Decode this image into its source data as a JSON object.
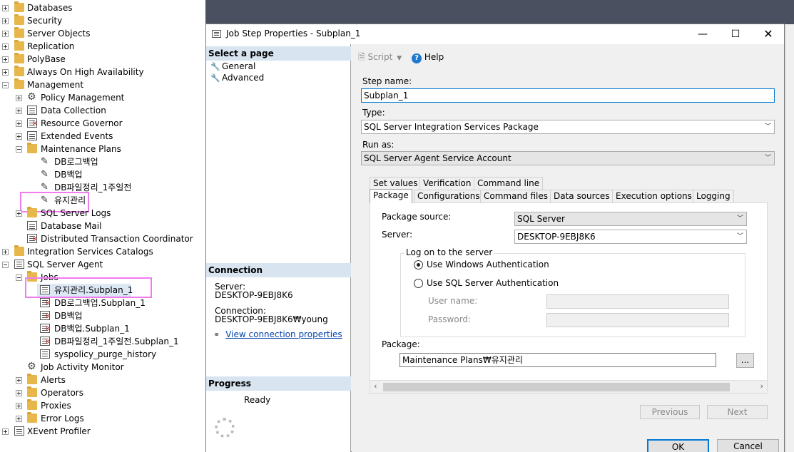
{
  "tree": {
    "items": [
      {
        "label": "Databases",
        "icon": "folder-icon"
      },
      {
        "label": "Security",
        "icon": "folder-icon"
      },
      {
        "label": "Server Objects",
        "icon": "folder-icon"
      },
      {
        "label": "Replication",
        "icon": "folder-icon"
      },
      {
        "label": "PolyBase",
        "icon": "folder-icon"
      },
      {
        "label": "Always On High Availability",
        "icon": "folder-icon"
      },
      {
        "label": "Management",
        "icon": "folder-icon"
      },
      {
        "label": "Policy Management",
        "icon": "policy-icon"
      },
      {
        "label": "Data Collection",
        "icon": "data-collection-icon"
      },
      {
        "label": "Resource Governor",
        "icon": "resource-governor-icon"
      },
      {
        "label": "Extended Events",
        "icon": "extended-events-icon"
      },
      {
        "label": "Maintenance Plans",
        "icon": "folder-icon"
      },
      {
        "label": "DB로그백업",
        "icon": "maintenance-plan-icon"
      },
      {
        "label": "DB백업",
        "icon": "maintenance-plan-icon"
      },
      {
        "label": "DB파일정리_1주일전",
        "icon": "maintenance-plan-icon"
      },
      {
        "label": "유지관리",
        "icon": "maintenance-plan-icon"
      },
      {
        "label": "SQL Server Logs",
        "icon": "folder-icon"
      },
      {
        "label": "Database Mail",
        "icon": "database-mail-icon"
      },
      {
        "label": "Distributed Transaction Coordinator",
        "icon": "dtc-icon"
      },
      {
        "label": "Integration Services Catalogs",
        "icon": "folder-icon"
      },
      {
        "label": "SQL Server Agent",
        "icon": "sql-agent-icon"
      },
      {
        "label": "Jobs",
        "icon": "folder-icon"
      },
      {
        "label": "유지관리.Subplan_1",
        "icon": "job-icon"
      },
      {
        "label": "DB로그백업.Subplan_1",
        "icon": "job-failed-icon"
      },
      {
        "label": "DB백업",
        "icon": "job-failed-icon"
      },
      {
        "label": "DB백업.Subplan_1",
        "icon": "job-failed-icon"
      },
      {
        "label": "DB파일정리_1주일전.Subplan_1",
        "icon": "job-failed-icon"
      },
      {
        "label": "syspolicy_purge_history",
        "icon": "job-icon"
      },
      {
        "label": "Job Activity Monitor",
        "icon": "job-activity-monitor-icon"
      },
      {
        "label": "Alerts",
        "icon": "folder-icon"
      },
      {
        "label": "Operators",
        "icon": "folder-icon"
      },
      {
        "label": "Proxies",
        "icon": "folder-icon"
      },
      {
        "label": "Error Logs",
        "icon": "folder-icon"
      },
      {
        "label": "XEvent Profiler",
        "icon": "xevent-profiler-icon"
      }
    ]
  },
  "dialog": {
    "title": "Job Step Properties - Subplan_1",
    "select_page_header": "Select a page",
    "pages": [
      "General",
      "Advanced"
    ],
    "connection_header": "Connection",
    "server_label": "Server:",
    "server_value": "DESKTOP-9EBJ8K6",
    "connection_label": "Connection:",
    "connection_value": "DESKTOP-9EBJ8K6₩young",
    "view_connection_link": "View connection properties",
    "progress_header": "Progress",
    "progress_status": "Ready",
    "toolbar": {
      "script_label": "Script",
      "help_label": "Help"
    },
    "step_name_label": "Step name:",
    "step_name_value": "Subplan_1",
    "type_label": "Type:",
    "type_value": "SQL Server Integration Services Package",
    "run_as_label": "Run as:",
    "run_as_value": "SQL Server Agent Service Account",
    "tabs_row1": [
      "Set values",
      "Verification",
      "Command line"
    ],
    "tabs_row2": [
      "Package",
      "Configurations",
      "Command files",
      "Data sources",
      "Execution options",
      "Logging"
    ],
    "package_source_label": "Package source:",
    "package_source_value": "SQL Server",
    "server_field_label": "Server:",
    "server_field_value": "DESKTOP-9EBJ8K6",
    "logon_group_label": "Log on to the server",
    "windows_auth_label": "Use Windows Authentication",
    "sql_auth_label": "Use SQL Server Authentication",
    "user_name_label": "User name:",
    "password_label": "Password:",
    "package_label": "Package:",
    "package_value": "Maintenance Plans₩유지관리",
    "browse_label": "...",
    "previous_label": "Previous",
    "next_label": "Next",
    "ok_label": "OK",
    "cancel_label": "Cancel"
  }
}
